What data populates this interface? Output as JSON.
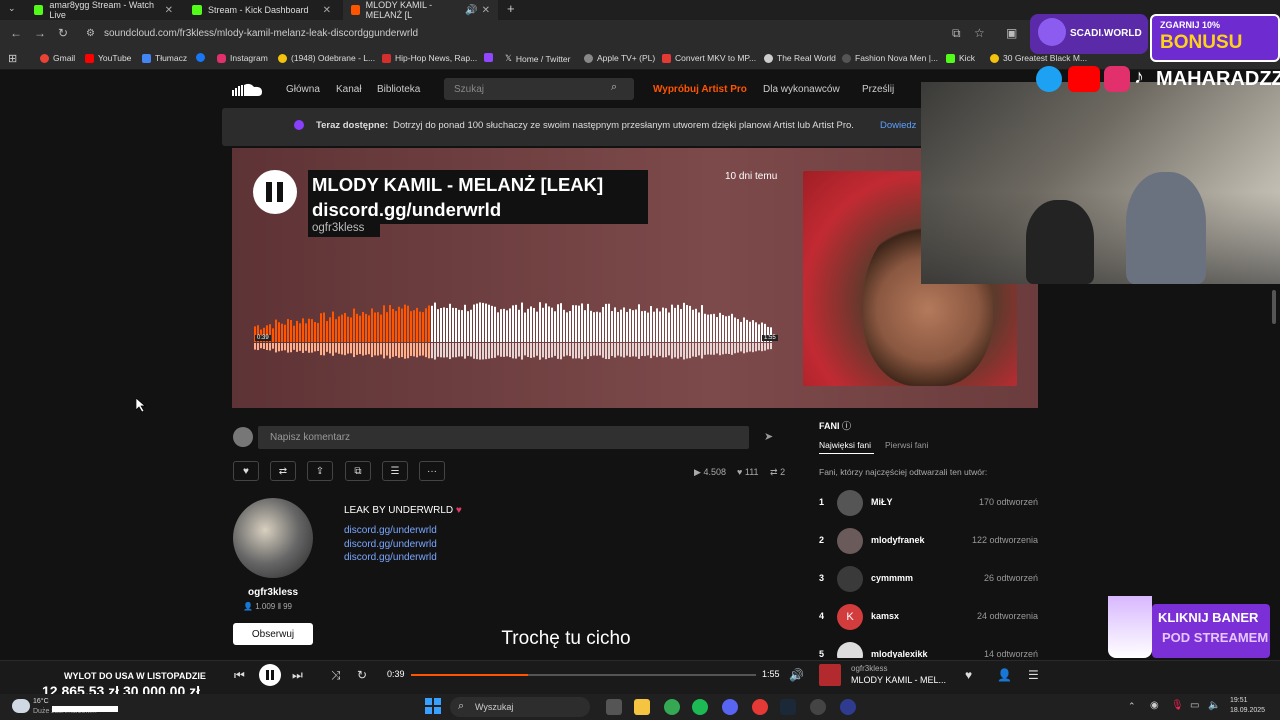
{
  "browser": {
    "tabs": [
      {
        "label": "amar8ygg Stream - Watch Live",
        "color": "#53fc18"
      },
      {
        "label": "Stream - Kick Dashboard",
        "color": "#53fc18"
      },
      {
        "label": "MLODY KAMIL - MELANŻ [L",
        "color": "#ff5500"
      }
    ],
    "new_tab": "+",
    "url": "soundcloud.com/fr3kless/mlody-kamil-melanz-leak-discordggunderwrld",
    "bookmarks": [
      "Gmail",
      "YouTube",
      "Tłumacz",
      "Instagram",
      "(1948) Odebrane - L...",
      "Hip-Hop News, Rap...",
      "Home / Twitter",
      "Apple TV+ (PL)",
      "Convert MKV to MP...",
      "The Real World",
      "Fashion Nova Men |...",
      "Kick",
      "30 Greatest Black M..."
    ]
  },
  "soundcloud": {
    "nav": [
      "Główna",
      "Kanał",
      "Biblioteka"
    ],
    "search_placeholder": "Szukaj",
    "artist_pro": "Wypróbuj Artist Pro",
    "for_artists": "Dla wykonawców",
    "upload": "Prześlij",
    "banner_bold": "Teraz dostępne:",
    "banner_text": "Dotrzyj do ponad 100 słuchaczy ze swoim następnym przesłanym utworem dzięki planowi Artist lub Artist Pro.",
    "banner_link": "Dowiedz"
  },
  "track": {
    "title_line1": "MLODY KAMIL - MELANŻ [LEAK]",
    "title_line2": "discord.gg/underwrld",
    "artist": "ogfr3kless",
    "posted": "10 dni temu",
    "time_current": "0:39",
    "time_total": "1:55",
    "progress": 0.339,
    "comment_placeholder": "Napisz komentarz",
    "plays": "4.508",
    "likes": "111",
    "reposts": "2",
    "description_title": "LEAK BY UNDERWRLD",
    "description_links": [
      "discord.gg/underwrld",
      "discord.gg/underwrld",
      "discord.gg/underwrld"
    ]
  },
  "uploader": {
    "name": "ogfr3kless",
    "followers": "1.009",
    "tracks": "99",
    "follow_label": "Obserwuj"
  },
  "fans": {
    "title": "FANI",
    "tab_top": "Najwięksi fani",
    "tab_first": "Pierwsi fani",
    "subtitle": "Fani, którzy najczęściej odtwarzali ten utwór:",
    "list": [
      {
        "rank": "1",
        "name": "MiŁY",
        "count": "170 odtworzeń"
      },
      {
        "rank": "2",
        "name": "mlodyfranek",
        "count": "122 odtworzenia"
      },
      {
        "rank": "3",
        "name": "cymmmm",
        "count": "26 odtworzeń"
      },
      {
        "rank": "4",
        "name": "kamsx",
        "count": "24 odtworzenia"
      },
      {
        "rank": "5",
        "name": "mlodyalexikk",
        "count": "14 odtworzeń"
      }
    ]
  },
  "player": {
    "time_current": "0:39",
    "time_total": "1:55",
    "artist": "ogfr3kless",
    "title": "MLODY KAMIL - MEL..."
  },
  "stream_overlay": {
    "subtitle": "Trochę tu cicho",
    "goal_title": "WYLOT DO USA W LISTOPADZIE",
    "goal_value": "12 865,53 zł  30 000,00 zł",
    "site": "SCADI.WORLD",
    "promo_small": "ZGARNIJ 10%",
    "promo_big": "BONUSU",
    "handle": "MAHARADZZA",
    "banner_line1": "KLIKNIJ BANER",
    "banner_line2": "POD STREAMEM"
  },
  "taskbar": {
    "search": "Wyszukaj",
    "weather_temp": "16°C",
    "weather_desc": "Duże zachmurzeni...",
    "time": "19:51",
    "date": "18.09.2025"
  }
}
